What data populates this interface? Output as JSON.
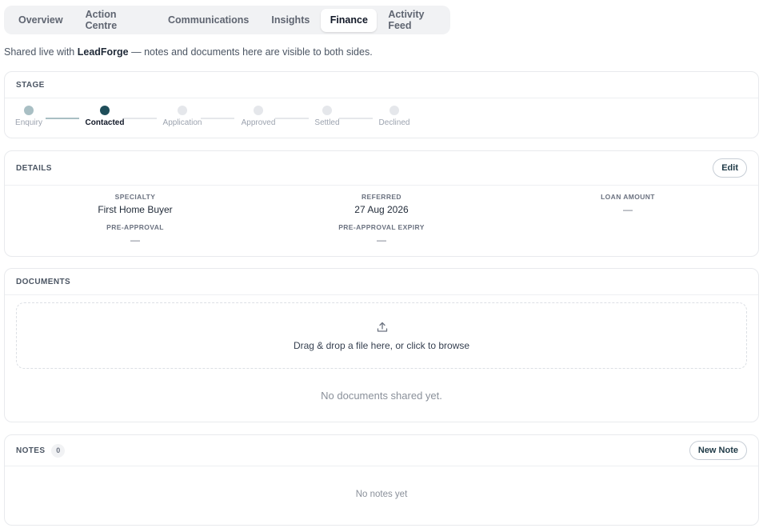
{
  "tabs": [
    {
      "label": "Overview"
    },
    {
      "label": "Action Centre"
    },
    {
      "label": "Communications"
    },
    {
      "label": "Insights"
    },
    {
      "label": "Finance"
    },
    {
      "label": "Activity Feed"
    }
  ],
  "shared": {
    "prefix": "Shared live with",
    "partner": "LeadForge",
    "suffix": "— notes and documents here are visible to both sides."
  },
  "stage": {
    "heading": "STAGE",
    "steps": [
      {
        "label": "Enquiry"
      },
      {
        "label": "Contacted"
      },
      {
        "label": "Application"
      },
      {
        "label": "Approved"
      },
      {
        "label": "Settled"
      },
      {
        "label": "Declined"
      }
    ],
    "current_step": "Contacted",
    "colors": {
      "completed": "#a9bfc4",
      "current": "#1f4e5a",
      "pending": "#e5e7eb"
    }
  },
  "details": {
    "heading": "DETAILS",
    "edit_label": "Edit",
    "fields": {
      "specialty": {
        "label": "SPECIALTY",
        "value": "First Home Buyer"
      },
      "referred": {
        "label": "REFERRED",
        "value": "27 Aug 2026"
      },
      "loan_amount": {
        "label": "LOAN AMOUNT",
        "value": "—"
      },
      "pre_approval": {
        "label": "PRE-APPROVAL",
        "value": "—"
      },
      "pre_approval_expiry": {
        "label": "PRE-APPROVAL EXPIRY",
        "value": "—"
      }
    }
  },
  "documents": {
    "heading": "DOCUMENTS",
    "drop_text": "Drag & drop a file here, or click to browse",
    "empty_text": "No documents shared yet.",
    "icon": "upload-icon"
  },
  "notes": {
    "heading": "NOTES",
    "count": "0",
    "new_label": "New Note",
    "empty_text": "No notes yet"
  }
}
